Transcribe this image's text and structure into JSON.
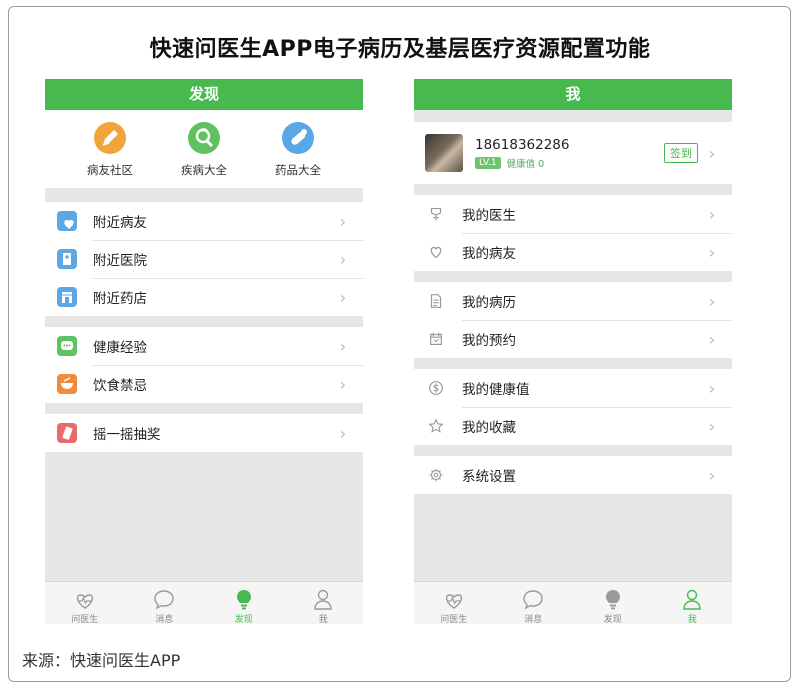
{
  "title": "快速问医生APP电子病历及基层医疗资源配置功能",
  "source": "来源：快速问医生APP",
  "colors": {
    "accent": "#48b94e",
    "tab_inactive": "#9a9a9a"
  },
  "left": {
    "header": "发现",
    "quick": [
      {
        "label": "病友社区",
        "icon": "pencil-icon",
        "color": "#f0a43c"
      },
      {
        "label": "疾病大全",
        "icon": "magnifier-icon",
        "color": "#5dc25f"
      },
      {
        "label": "药品大全",
        "icon": "pill-icon",
        "color": "#5aa6e6"
      }
    ],
    "groups": [
      [
        {
          "label": "附近病友",
          "icon": "hearts-icon",
          "color": "#5ea7e6"
        },
        {
          "label": "附近医院",
          "icon": "hospital-icon",
          "color": "#5ea7e6"
        },
        {
          "label": "附近药店",
          "icon": "store-icon",
          "color": "#5ea7e6"
        }
      ],
      [
        {
          "label": "健康经验",
          "icon": "chat-icon",
          "color": "#5dc25f"
        },
        {
          "label": "饮食禁忌",
          "icon": "bowl-icon",
          "color": "#f08a3c"
        }
      ],
      [
        {
          "label": "摇一摇抽奖",
          "icon": "phone-shake-icon",
          "color": "#ea6a6a"
        }
      ]
    ]
  },
  "right": {
    "header": "我",
    "profile": {
      "phone": "18618362286",
      "level": "LV.1",
      "health": "健康值 0",
      "checkin": "签到"
    },
    "groups": [
      [
        {
          "label": "我的医生",
          "icon": "doctor-icon"
        },
        {
          "label": "我的病友",
          "icon": "heart-icon"
        }
      ],
      [
        {
          "label": "我的病历",
          "icon": "document-icon"
        },
        {
          "label": "我的预约",
          "icon": "calendar-icon"
        }
      ],
      [
        {
          "label": "我的健康值",
          "icon": "dollar-icon"
        },
        {
          "label": "我的收藏",
          "icon": "star-icon"
        }
      ],
      [
        {
          "label": "系统设置",
          "icon": "gear-icon"
        }
      ]
    ]
  },
  "tabs": [
    {
      "label": "问医生",
      "icon": "heart-pulse-icon"
    },
    {
      "label": "消息",
      "icon": "speech-bubble-icon"
    },
    {
      "label": "发现",
      "icon": "lightbulb-icon"
    },
    {
      "label": "我",
      "icon": "person-icon"
    }
  ],
  "left_active_tab": 2,
  "right_active_tab": 3,
  "chevron": "›"
}
